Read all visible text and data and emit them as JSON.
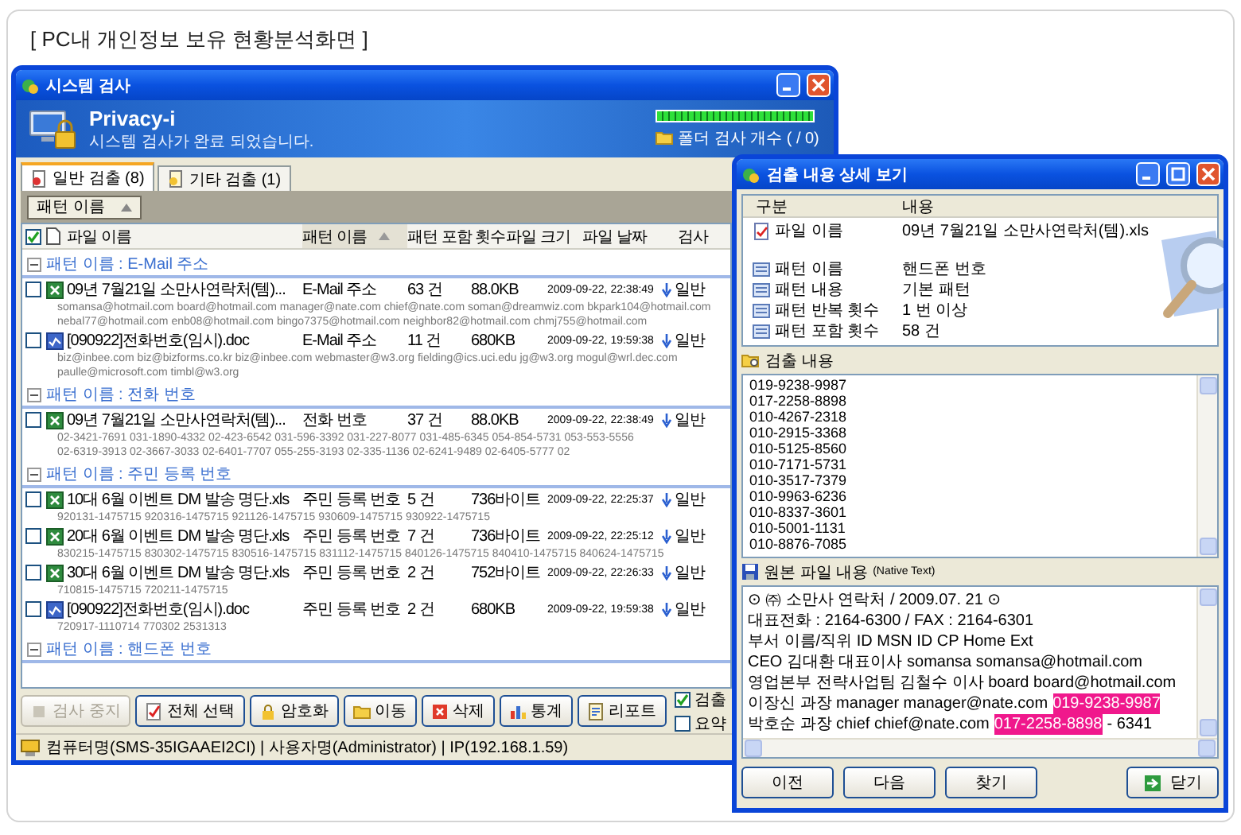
{
  "page_title": "[ PC내 개인정보 보유 현황분석화면 ]",
  "scan_window": {
    "title": "시스템 검사",
    "banner": {
      "product": "Privacy-i",
      "message": "시스템 검사가 완료 되었습니다.",
      "progress": {
        "level": 1
      },
      "folder_count": "폴더 검사 개수 ( / 0)"
    },
    "tabs": [
      {
        "label": "일반 검출 (8)",
        "selected": true
      },
      {
        "label": "기타 검출 (1)",
        "selected": false
      }
    ],
    "group_by": "패턴 이름",
    "header_checked": true,
    "columns": [
      {
        "label": "파일 이름",
        "sorted": false
      },
      {
        "label": "패턴 이름",
        "sorted": true
      },
      {
        "label": "패턴 포함 횟수",
        "sorted": false
      },
      {
        "label": "파일 크기",
        "sorted": false
      },
      {
        "label": "파일 날짜",
        "sorted": false
      },
      {
        "label": "검사",
        "sorted": false
      }
    ],
    "groups": [
      {
        "label": "패턴 이름 : E-Mail 주소",
        "expanded": true,
        "files": [
          {
            "kind": "excel",
            "checked": false,
            "name": "09년 7월21일 소만사연락처(템)...",
            "pattern": "E-Mail 주소",
            "count": "63 건",
            "size": "88.0KB",
            "date": "2009-09-22, 22:38:49",
            "scan_type": "일반",
            "matches": [
              "somansa@hotmail.com board@hotmail.com manager@nate.com chief@nate.com soman@dreamwiz.com bkpark104@hotmail.com",
              "nebal77@hotmail.com enb08@hotmail.com bingo7375@hotmail.com neighbor82@hotmail.com chmj755@hotmail.com"
            ]
          },
          {
            "kind": "word",
            "checked": false,
            "name": "[090922]전화번호(임시).doc",
            "pattern": "E-Mail 주소",
            "count": "11 건",
            "size": "680KB",
            "date": "2009-09-22, 19:59:38",
            "scan_type": "일반",
            "matches": [
              "biz@inbee.com biz@bizforms.co.kr biz@inbee.com webmaster@w3.org fielding@ics.uci.edu jg@w3.org mogul@wrl.dec.com",
              "paulle@microsoft.com timbl@w3.org"
            ]
          }
        ]
      },
      {
        "label": "패턴 이름 : 전화 번호",
        "expanded": true,
        "files": [
          {
            "kind": "excel",
            "checked": false,
            "name": "09년 7월21일 소만사연락처(템)...",
            "pattern": "전화 번호",
            "count": "37 건",
            "size": "88.0KB",
            "date": "2009-09-22, 22:38:49",
            "scan_type": "일반",
            "matches": [
              "02-3421-7691 031-1890-4332 02-423-6542 031-596-3392 031-227-8077 031-485-6345 054-854-5731 053-553-5556",
              "02-6319-3913 02-3667-3033 02-6401-7707 055-255-3193 02-335-1136 02-6241-9489 02-6405-5777 02"
            ]
          }
        ]
      },
      {
        "label": "패턴 이름 : 주민 등록 번호",
        "expanded": true,
        "files": [
          {
            "kind": "excel",
            "checked": false,
            "name": "10대 6월 이벤트 DM 발송 명단.xls",
            "pattern": "주민 등록 번호",
            "count": "5 건",
            "size": "736바이트",
            "date": "2009-09-22, 22:25:37",
            "scan_type": "일반",
            "matches": [
              "920131-1475715 920316-1475715 921126-1475715 930609-1475715 930922-1475715"
            ]
          },
          {
            "kind": "excel",
            "checked": false,
            "name": "20대 6월 이벤트 DM 발송 명단.xls",
            "pattern": "주민 등록 번호",
            "count": "7 건",
            "size": "736바이트",
            "date": "2009-09-22, 22:25:12",
            "scan_type": "일반",
            "matches": [
              "830215-1475715 830302-1475715 830516-1475715 831112-1475715 840126-1475715 840410-1475715 840624-1475715"
            ]
          },
          {
            "kind": "excel",
            "checked": false,
            "name": "30대 6월 이벤트 DM 발송 명단.xls",
            "pattern": "주민 등록 번호",
            "count": "2 건",
            "size": "752바이트",
            "date": "2009-09-22, 22:26:33",
            "scan_type": "일반",
            "matches": [
              "710815-1475715 720211-1475715"
            ]
          },
          {
            "kind": "word",
            "checked": false,
            "name": "[090922]전화번호(임시).doc",
            "pattern": "주민 등록 번호",
            "count": "2 건",
            "size": "680KB",
            "date": "2009-09-22, 19:59:38",
            "scan_type": "일반",
            "matches": [
              "720917-1110714 770302 2531313"
            ]
          }
        ]
      },
      {
        "label": "패턴 이름 : 핸드폰 번호",
        "expanded": true
      }
    ],
    "buttons": [
      {
        "label": "검사 중지",
        "disabled": true
      },
      {
        "label": "전체 선택",
        "disabled": false
      },
      {
        "label": "암호화",
        "disabled": false
      },
      {
        "label": "이동",
        "disabled": false
      },
      {
        "label": "삭제",
        "disabled": false
      },
      {
        "label": "통계",
        "disabled": false
      },
      {
        "label": "리포트",
        "disabled": false
      }
    ],
    "options": [
      {
        "label": "검출",
        "checked": true
      },
      {
        "label": "요약",
        "checked": false
      }
    ],
    "status_bar": "컴퓨터명(SMS-35IGAAEI2CI) | 사용자명(Administrator) | IP(192.168.1.59)"
  },
  "detail_window": {
    "title": "검출 내용 상세 보기",
    "columns": [
      "구분",
      "내용"
    ],
    "file": {
      "label": "파일 이름",
      "value": "09년 7월21일 소만사연락처(템).xls"
    },
    "pattern_fields": [
      {
        "label": "패턴 이름",
        "value": "핸드폰 번호"
      },
      {
        "label": "패턴 내용",
        "value": "기본 패턴"
      },
      {
        "label": "패턴 반복 횟수",
        "value": "1 번 이상"
      },
      {
        "label": "패턴 포함 횟수",
        "value": "58 건"
      }
    ],
    "matches_label": "검출 내용",
    "matches": [
      "019-9238-9987",
      "017-2258-8898",
      "010-4267-2318",
      "010-2915-3368",
      "010-5125-8560",
      "010-7171-5731",
      "010-3517-7379",
      "010-9963-6236",
      "010-8337-3601",
      "010-5001-1131",
      "010-8876-7085"
    ],
    "source_label": "원본 파일 내용",
    "source_note": "(Native Text)",
    "source_lines": [
      [
        {
          "text": "⊙ ㈜ 소만사 연락처 / 2009.07. 21 ⊙",
          "highlighted": false
        }
      ],
      [
        {
          "text": "대표전화 : 2164-6300 / FAX : 2164-6301",
          "highlighted": false
        }
      ],
      [
        {
          "text": "부서 이름/직위 ID MSN ID CP Home Ext",
          "highlighted": false
        }
      ],
      [
        {
          "text": "CEO 김대환 대표이사 somansa somansa@hotmail.com",
          "highlighted": false
        }
      ],
      [
        {
          "text": "영업본부 전략사업팀 김철수 이사 board board@hotmail.com",
          "highlighted": false
        }
      ],
      [
        {
          "text": "이장신 과장 manager manager@nate.com",
          "highlighted": false
        },
        {
          "text": "019-9238-9987",
          "highlighted": true
        }
      ],
      [
        {
          "text": "박호순 과장 chief chief@nate.com",
          "highlighted": false
        },
        {
          "text": "017-2258-8898",
          "highlighted": true
        },
        {
          "text": "- 6341",
          "highlighted": false
        }
      ]
    ],
    "buttons": [
      {
        "label": "이전",
        "kind": "plain"
      },
      {
        "label": "다음",
        "kind": "plain"
      },
      {
        "label": "찾기",
        "kind": "plain"
      },
      {
        "label": "닫기",
        "kind": "close"
      }
    ]
  }
}
